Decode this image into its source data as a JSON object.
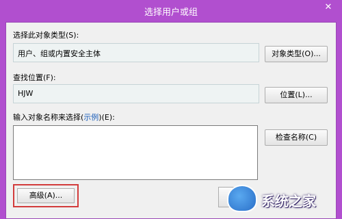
{
  "window": {
    "title": "选择用户或组",
    "close_glyph": "✕"
  },
  "object_type": {
    "label": "选择此对象类型(S):",
    "value": "用户、组或内置安全主体",
    "button": "对象类型(O)..."
  },
  "location": {
    "label": "查找位置(F):",
    "value": "HJW",
    "button": "位置(L)..."
  },
  "names": {
    "label_prefix": "输入对象名称来选择(",
    "label_link": "示例",
    "label_suffix": ")(E):",
    "value": "",
    "check_button": "检查名称(C)"
  },
  "footer": {
    "advanced_button": "高级(A)..."
  },
  "watermark": {
    "text": "系统之家"
  },
  "colors": {
    "title_bar": "#b14fcf",
    "highlight_border": "#d23b3b",
    "link": "#1a5cb8"
  }
}
